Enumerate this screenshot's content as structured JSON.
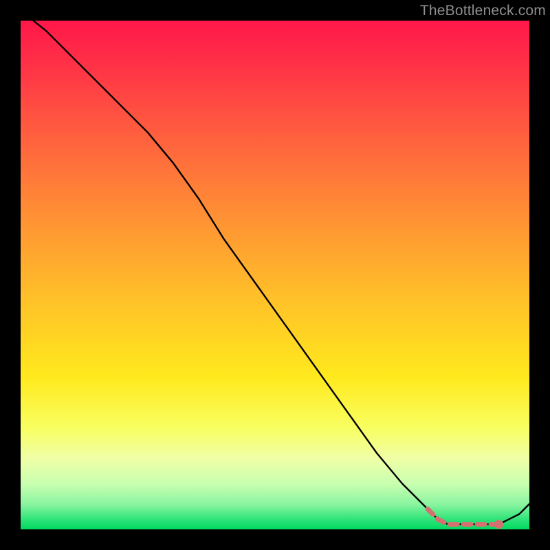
{
  "watermark": "TheBottleneck.com",
  "colors": {
    "gradient_top": "#ff1749",
    "gradient_mid1": "#ff8f34",
    "gradient_mid2": "#ffe91d",
    "gradient_bottom": "#00d860",
    "curve": "#000000",
    "marker": "#d67070"
  },
  "chart_data": {
    "type": "line",
    "title": "",
    "xlabel": "",
    "ylabel": "",
    "xlim": [
      0,
      100
    ],
    "ylim": [
      0,
      100
    ],
    "grid": false,
    "legend": false,
    "axes_visible": false,
    "series": [
      {
        "name": "curve",
        "style": "solid",
        "color": "#000000",
        "x": [
          0,
          5,
          10,
          15,
          20,
          25,
          30,
          35,
          40,
          45,
          50,
          55,
          60,
          65,
          70,
          75,
          80,
          82,
          84,
          86,
          88,
          90,
          92,
          94,
          96,
          98,
          100
        ],
        "y": [
          102,
          98,
          93,
          88,
          83,
          78,
          72,
          65,
          57,
          50,
          43,
          36,
          29,
          22,
          15,
          9,
          4,
          2,
          1,
          1,
          1,
          1,
          1,
          1,
          2,
          3,
          5
        ]
      },
      {
        "name": "highlight-dashes",
        "style": "dashed-markers",
        "color": "#d67070",
        "x": [
          80,
          82,
          84,
          86,
          88,
          90,
          92,
          94
        ],
        "y": [
          4,
          2,
          1,
          1,
          1,
          1,
          1,
          1
        ]
      }
    ],
    "marker": {
      "x": 94,
      "y": 1,
      "color": "#d67070"
    }
  }
}
